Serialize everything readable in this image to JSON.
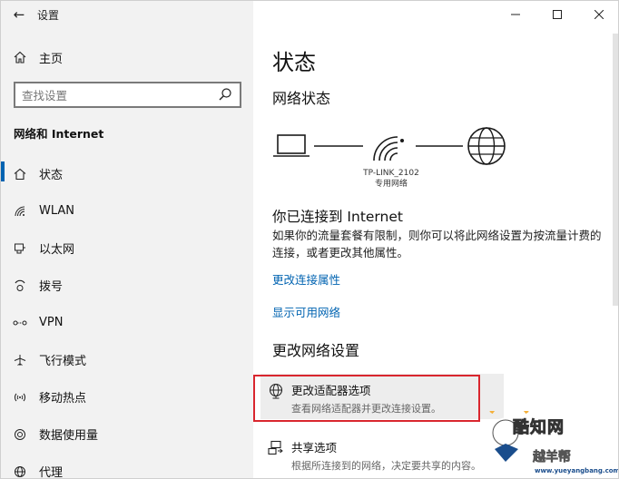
{
  "window": {
    "title": "设置",
    "controls": [
      "–",
      "☐",
      "✕"
    ]
  },
  "sidebar": {
    "home_label": "主页",
    "search_placeholder": "查找设置",
    "section_title": "网络和 Internet",
    "items": [
      {
        "label": "状态",
        "icon": "home-status-icon",
        "active": true
      },
      {
        "label": "WLAN",
        "icon": "wifi-icon"
      },
      {
        "label": "以太网",
        "icon": "ethernet-icon"
      },
      {
        "label": "拨号",
        "icon": "dialup-icon"
      },
      {
        "label": "VPN",
        "icon": "vpn-icon"
      },
      {
        "label": "飞行模式",
        "icon": "airplane-icon"
      },
      {
        "label": "移动热点",
        "icon": "hotspot-icon"
      },
      {
        "label": "数据使用量",
        "icon": "data-usage-icon"
      },
      {
        "label": "代理",
        "icon": "globe-icon"
      }
    ]
  },
  "main": {
    "title": "状态",
    "network_status_title": "网络状态",
    "network_name": "TP-LINK_2102",
    "network_type": "专用网络",
    "connected_title": "你已连接到 Internet",
    "connected_desc": "如果你的流量套餐有限制，则你可以将此网络设置为按流量计费的连接，或者更改其他属性。",
    "link_change_props": "更改连接属性",
    "link_show_networks": "显示可用网络",
    "change_settings_title": "更改网络设置",
    "options": [
      {
        "title": "更改适配器选项",
        "subtitle": "查看网络适配器并更改连接设置。"
      },
      {
        "title": "共享选项",
        "subtitle": "根据所连接到的网络，决定要共享的内容。"
      }
    ]
  },
  "watermark": {
    "brand": "酷知网",
    "cn_text": "越羊帮",
    "url": "www.yueyangbang.com"
  },
  "colors": {
    "accent": "#0063b1",
    "highlight": "#d9262e",
    "sidebar_bg": "#f2f2f2"
  }
}
